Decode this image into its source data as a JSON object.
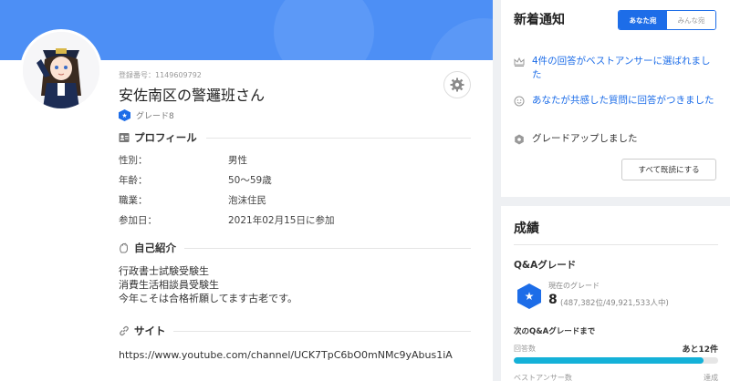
{
  "profile": {
    "reg_number": "登録番号：1149609792",
    "username": "安佐南区の警邏班さん",
    "grade": "グレード8",
    "grade_badge": "8",
    "profile_section": "プロフィール",
    "fields": [
      {
        "label": "性別：",
        "value": "男性"
      },
      {
        "label": "年齢：",
        "value": "50〜59歳"
      },
      {
        "label": "職業：",
        "value": "泡沫住民"
      },
      {
        "label": "参加日：",
        "value": "2021年02月15日に参加"
      }
    ],
    "intro_section": "自己紹介",
    "intro": "行政書士試験受験生\n消費生活相談員受験生\n今年こそは合格祈願してます古老です。",
    "site_section": "サイト",
    "site_url": "https://www.youtube.com/channel/UCK7TpC6bO0mNMc9yAbus1iA"
  },
  "notifications": {
    "title": "新着通知",
    "tabs": [
      "あなた宛",
      "みんな宛"
    ],
    "active_tab": "あなた宛",
    "items": [
      {
        "icon": "crown-icon",
        "text": "4件の回答がベストアンサーに選ばれました",
        "link": true
      },
      {
        "icon": "smile-icon",
        "text": "あなたが共感した質問に回答がつきました",
        "link": true
      },
      {
        "icon": "gear-icon",
        "text": "グレードアップしました",
        "link": false
      }
    ],
    "mark_all_read": "すべて既読にする"
  },
  "results": {
    "title": "成績",
    "qa_grade_label": "Q&Aグレード",
    "current_grade_label": "現在のグレード",
    "grade_value": "8",
    "rank": "(487,382位/49,921,533人中)",
    "next_grade_label": "次のQ&Aグレードまで",
    "answers_label": "回答数",
    "answers_remaining": "あと12件",
    "answers_progress": 0.93,
    "best_answers_label": "ベストアンサー数",
    "achieved_label": "達成"
  },
  "colors": {
    "accent": "#1d6de8",
    "banner": "#4d8ff5",
    "progress": "#14b1d8"
  }
}
